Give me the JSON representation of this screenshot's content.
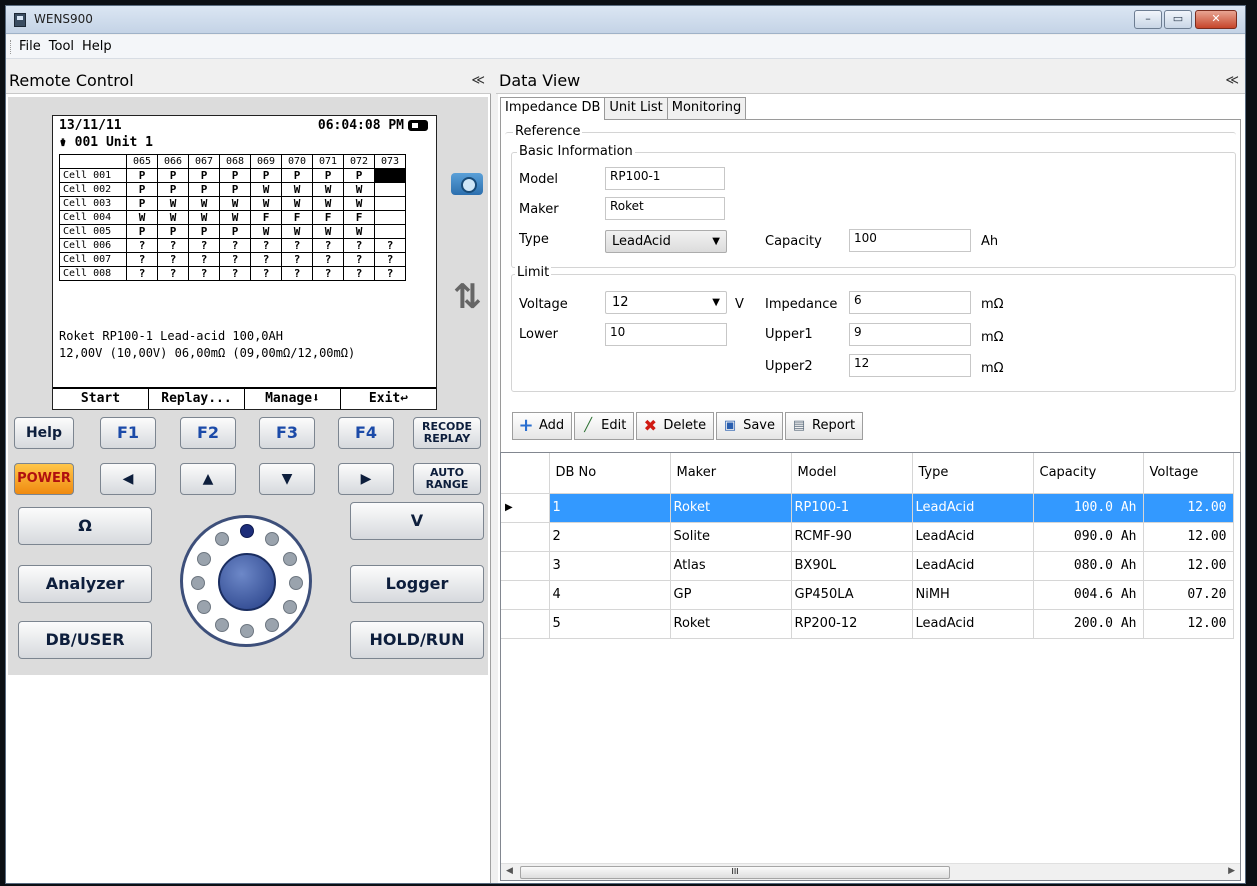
{
  "window": {
    "title": "WENS900",
    "minimize": "–",
    "maximize": "▭",
    "close": "✕"
  },
  "menu": [
    "File",
    "Tool",
    "Help"
  ],
  "remote": {
    "header": "Remote Control",
    "collapse": "≪",
    "screen": {
      "date": "13/11/11",
      "time": "06:04:08 PM",
      "unit": "001 Unit 1",
      "columns": [
        "065",
        "066",
        "067",
        "068",
        "069",
        "070",
        "071",
        "072",
        "073"
      ],
      "rows": [
        {
          "label": "Cell 001",
          "cells": [
            "P",
            "P",
            "P",
            "P",
            "P",
            "P",
            "P",
            "P",
            ""
          ]
        },
        {
          "label": "Cell 002",
          "cells": [
            "P",
            "P",
            "P",
            "P",
            "W",
            "W",
            "W",
            "W",
            ""
          ]
        },
        {
          "label": "Cell 003",
          "cells": [
            "P",
            "W",
            "W",
            "W",
            "W",
            "W",
            "W",
            "W",
            ""
          ]
        },
        {
          "label": "Cell 004",
          "cells": [
            "W",
            "W",
            "W",
            "W",
            "F",
            "F",
            "F",
            "F",
            ""
          ]
        },
        {
          "label": "Cell 005",
          "cells": [
            "P",
            "P",
            "P",
            "P",
            "W",
            "W",
            "W",
            "W",
            ""
          ]
        },
        {
          "label": "Cell 006",
          "cells": [
            "?",
            "?",
            "?",
            "?",
            "?",
            "?",
            "?",
            "?",
            "?"
          ]
        },
        {
          "label": "Cell 007",
          "cells": [
            "?",
            "?",
            "?",
            "?",
            "?",
            "?",
            "?",
            "?",
            "?"
          ]
        },
        {
          "label": "Cell 008",
          "cells": [
            "?",
            "?",
            "?",
            "?",
            "?",
            "?",
            "?",
            "?",
            "?"
          ]
        }
      ],
      "info1": "Roket RP100-1 Lead-acid 100,0AH",
      "info2": "12,00V (10,00V)    06,00mΩ (09,00mΩ/12,00mΩ)",
      "softkeys": [
        "Start",
        "Replay...",
        "Manage⬇",
        "Exit↩"
      ]
    },
    "keys": {
      "help": "Help",
      "f1": "F1",
      "f2": "F2",
      "f3": "F3",
      "f4": "F4",
      "recode1": "RECODE",
      "recode2": "REPLAY",
      "power": "POWER",
      "left": "◀",
      "up": "▲",
      "down": "▼",
      "right": "▶",
      "auto1": "AUTO",
      "auto2": "RANGE",
      "ohm": "Ω",
      "v": "V",
      "analyzer": "Analyzer",
      "logger": "Logger",
      "dbuser": "DB/USER",
      "holdrun": "HOLD/RUN"
    }
  },
  "dataview": {
    "header": "Data View",
    "collapse": "≪",
    "tabs": [
      "Impedance DB",
      "Unit List",
      "Monitoring"
    ],
    "form": {
      "reference": "Reference",
      "basic": "Basic Information",
      "model_label": "Model",
      "model_value": "RP100-1",
      "maker_label": "Maker",
      "maker_value": "Roket",
      "type_label": "Type",
      "type_value": "LeadAcid",
      "capacity_label": "Capacity",
      "capacity_value": "100",
      "capacity_unit": "Ah",
      "limit": "Limit",
      "voltage_label": "Voltage",
      "voltage_value": "12",
      "voltage_unit": "V",
      "impedance_label": "Impedance",
      "impedance_value": "6",
      "impedance_unit": "mΩ",
      "lower_label": "Lower",
      "lower_value": "10",
      "upper1_label": "Upper1",
      "upper1_value": "9",
      "upper1_unit": "mΩ",
      "upper2_label": "Upper2",
      "upper2_value": "12",
      "upper2_unit": "mΩ"
    },
    "toolbar": {
      "add": "Add",
      "edit": "Edit",
      "delete": "Delete",
      "save": "Save",
      "report": "Report"
    },
    "table": {
      "columns": [
        "DB No",
        "Maker",
        "Model",
        "Type",
        "Capacity",
        "Voltage"
      ],
      "rows": [
        {
          "no": "1",
          "maker": "Roket",
          "model": "RP100-1",
          "type": "LeadAcid",
          "capacity": "100.0 Ah",
          "voltage": "12.00"
        },
        {
          "no": "2",
          "maker": "Solite",
          "model": "RCMF-90",
          "type": "LeadAcid",
          "capacity": "090.0 Ah",
          "voltage": "12.00"
        },
        {
          "no": "3",
          "maker": "Atlas",
          "model": "BX90L",
          "type": "LeadAcid",
          "capacity": "080.0 Ah",
          "voltage": "12.00"
        },
        {
          "no": "4",
          "maker": "GP",
          "model": "GP450LA",
          "type": "NiMH",
          "capacity": "004.6 Ah",
          "voltage": "07.20"
        },
        {
          "no": "5",
          "maker": "Roket",
          "model": "RP200-12",
          "type": "LeadAcid",
          "capacity": "200.0 Ah",
          "voltage": "12.00"
        }
      ],
      "selected_row": 0,
      "row_pointer": "▶",
      "scroll_grip": "III"
    },
    "colors": {
      "selection": "#3399ff",
      "accent": "#1b4aa8"
    }
  }
}
